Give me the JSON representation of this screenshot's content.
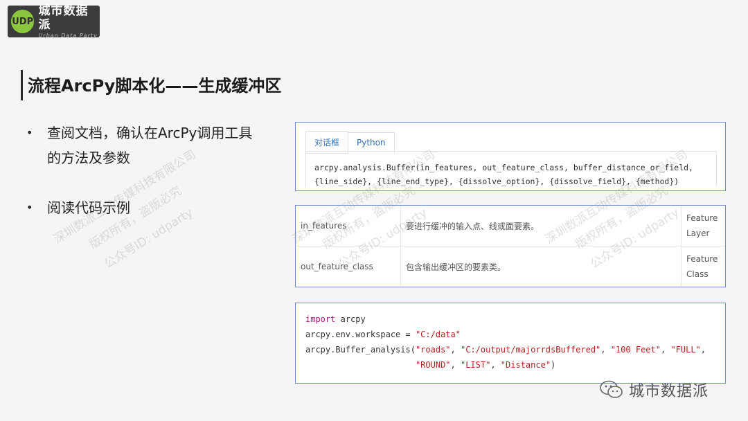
{
  "logo": {
    "mark": "UDP",
    "name_cn": "城市数据派",
    "name_en": "Urban Data Party"
  },
  "slide": {
    "title": "流程ArcPy脚本化——生成缓冲区",
    "bullets": [
      {
        "dot": "•",
        "lines": [
          "查阅文档，确认在ArcPy调用工具",
          "的方法及参数"
        ]
      },
      {
        "dot": "•",
        "lines": [
          "阅读代码示例"
        ]
      }
    ]
  },
  "watermark": {
    "line1": "深圳数派互动传媒科技有限公司",
    "line2": "版权所有，盗版必究",
    "line3": "公众号ID: udparty"
  },
  "doc_panel": {
    "tabs": [
      "对话框",
      "Python"
    ],
    "active_tab": "Python",
    "signature_line1": "arcpy.analysis.Buffer(in_features, out_feature_class, buffer_distance_or_field,",
    "signature_line2": "{line_side}, {line_end_type}, {dissolve_option}, {dissolve_field}, {method})"
  },
  "param_table": {
    "rows": [
      {
        "name": "in_features",
        "desc": "要进行缓冲的输入点、线或面要素。",
        "type_l1": "Feature",
        "type_l2": "Layer"
      },
      {
        "name": "out_feature_class",
        "desc": "包含输出缓冲区的要素类。",
        "type_l1": "Feature",
        "type_l2": "Class"
      }
    ]
  },
  "code_sample": {
    "l1_kw": "import",
    "l1_rest": " arcpy",
    "l2_pre": "arcpy.env.workspace = ",
    "l2_str": "\"C:/data\"",
    "l3_pre": "arcpy.Buffer_analysis(",
    "l3_s1": "\"roads\"",
    "l3_s2": "\"C:/output/majorrdsBuffered\"",
    "l3_s3": "\"100 Feet\"",
    "l3_s4": "\"FULL\"",
    "l4_indent": "                      ",
    "l4_s1": "\"ROUND\"",
    "l4_s2": "\"LIST\"",
    "l4_s3": "\"Distance\"",
    "sep": ", ",
    "close": ")"
  },
  "footer": {
    "text": "城市数据派",
    "icon": "wechat-icon"
  }
}
